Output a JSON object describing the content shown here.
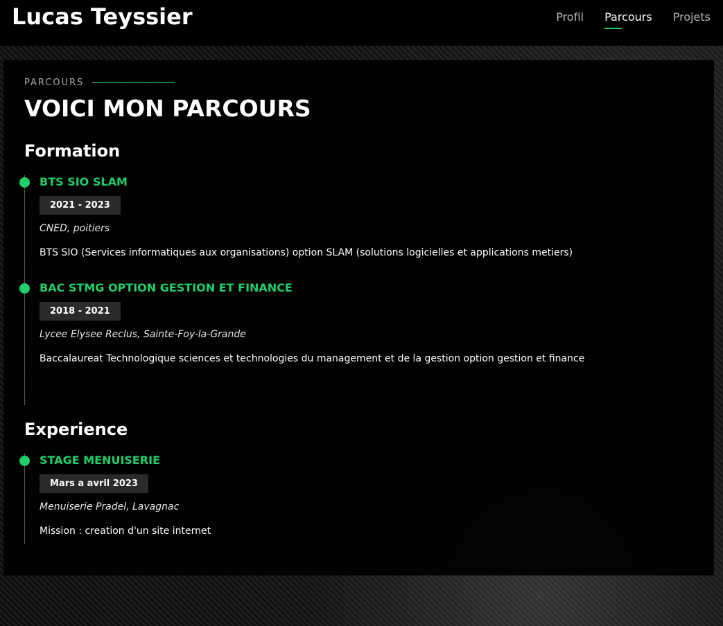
{
  "header": {
    "brand": "Lucas Teyssier",
    "nav": [
      {
        "label": "Profil",
        "active": false
      },
      {
        "label": "Parcours",
        "active": true
      },
      {
        "label": "Projets",
        "active": false
      }
    ]
  },
  "section": {
    "kicker": "PARCOURS",
    "title": "VOICI MON PARCOURS"
  },
  "formation": {
    "title": "Formation",
    "items": [
      {
        "title": "BTS SIO SLAM",
        "date": "2021 - 2023",
        "place": "CNED, poitiers",
        "description": "BTS SIO (Services informatiques aux organisations) option SLAM (solutions logicielles et applications metiers)"
      },
      {
        "title": "BAC STMG OPTION GESTION ET FINANCE",
        "date": "2018 - 2021",
        "place": "Lycee Elysee Reclus, Sainte-Foy-la-Grande",
        "description": "Baccalaureat Technologique sciences et technologies du management et de la gestion option gestion et finance"
      }
    ]
  },
  "experience": {
    "title": "Experience",
    "items": [
      {
        "title": "STAGE MENUISERIE",
        "date": "Mars a avril 2023",
        "place": "Menuiserie Pradel, Lavagnac",
        "description": "Mission : creation d'un site internet"
      }
    ]
  },
  "colors": {
    "accent": "#1fcf6a",
    "panel": "#000000",
    "date_badge": "#2a2a2a"
  }
}
